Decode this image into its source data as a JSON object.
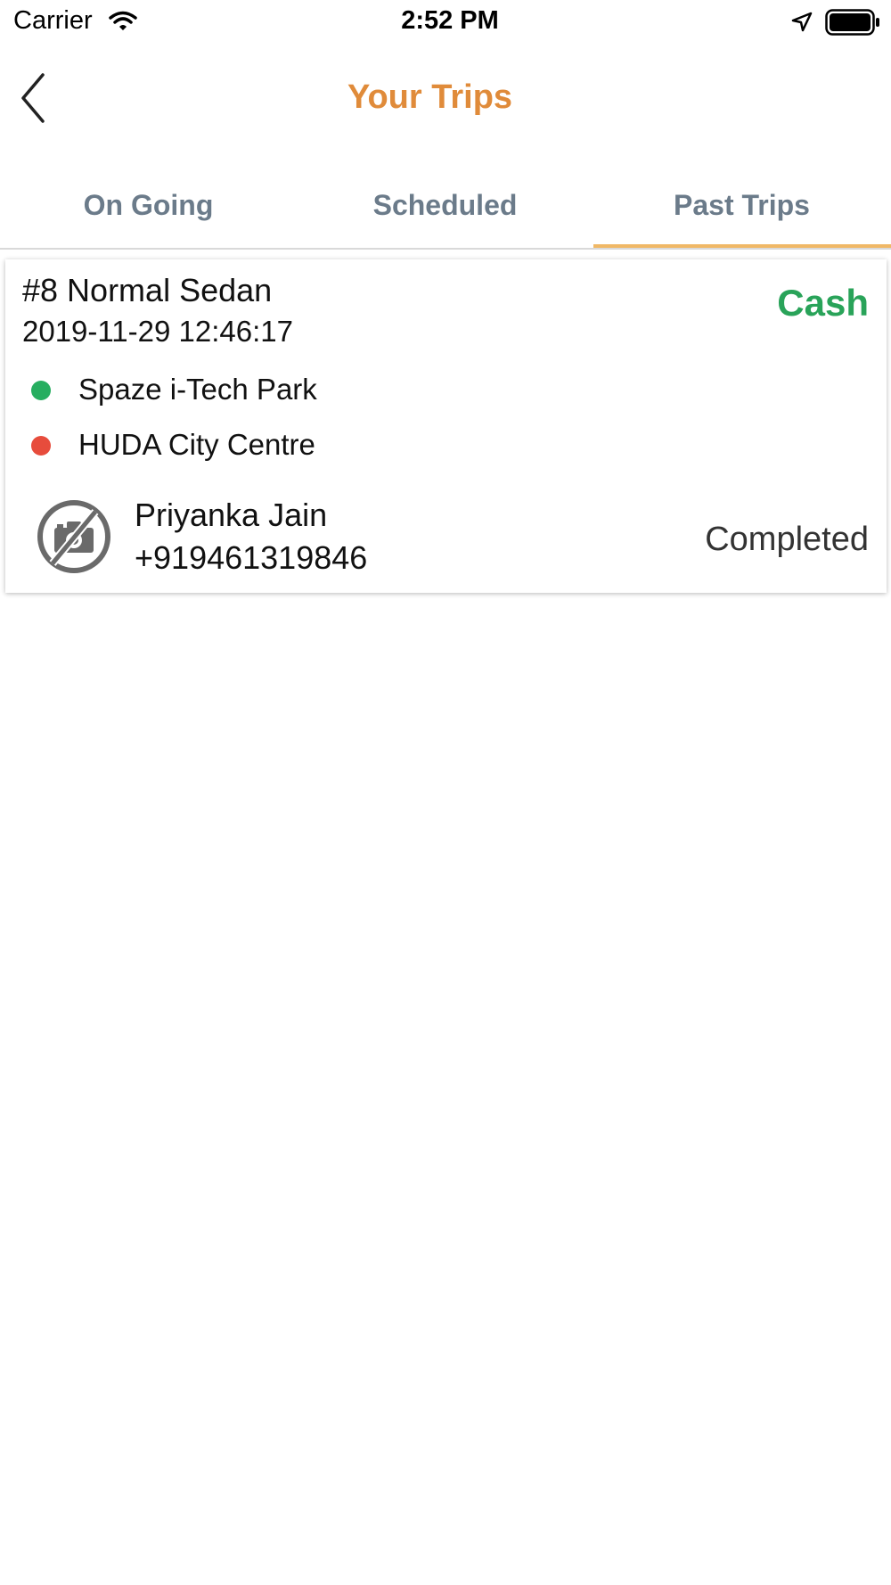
{
  "status_bar": {
    "carrier": "Carrier",
    "time": "2:52 PM",
    "icons": [
      "wifi-icon",
      "location-arrow-icon",
      "battery-icon"
    ]
  },
  "header": {
    "title": "Your Trips",
    "back_icon": "chevron-left-icon"
  },
  "tabs": [
    {
      "label": "On Going",
      "active": false
    },
    {
      "label": "Scheduled",
      "active": false
    },
    {
      "label": "Past Trips",
      "active": true
    }
  ],
  "trips": [
    {
      "title": "#8 Normal Sedan",
      "datetime": "2019-11-29 12:46:17",
      "payment": "Cash",
      "pickup": "Spaze i-Tech Park",
      "dropoff": "HUDA City Centre",
      "driver_name": "Priyanka Jain",
      "driver_phone": "+919461319846",
      "status": "Completed",
      "avatar_icon": "no-photo-icon"
    }
  ],
  "colors": {
    "title": "#e08b3a",
    "tab_text": "#6b7b8a",
    "tab_indicator": "#f0b866",
    "payment": "#29a359",
    "pickup_dot": "#27ae60",
    "dropoff_dot": "#e74c3c"
  }
}
